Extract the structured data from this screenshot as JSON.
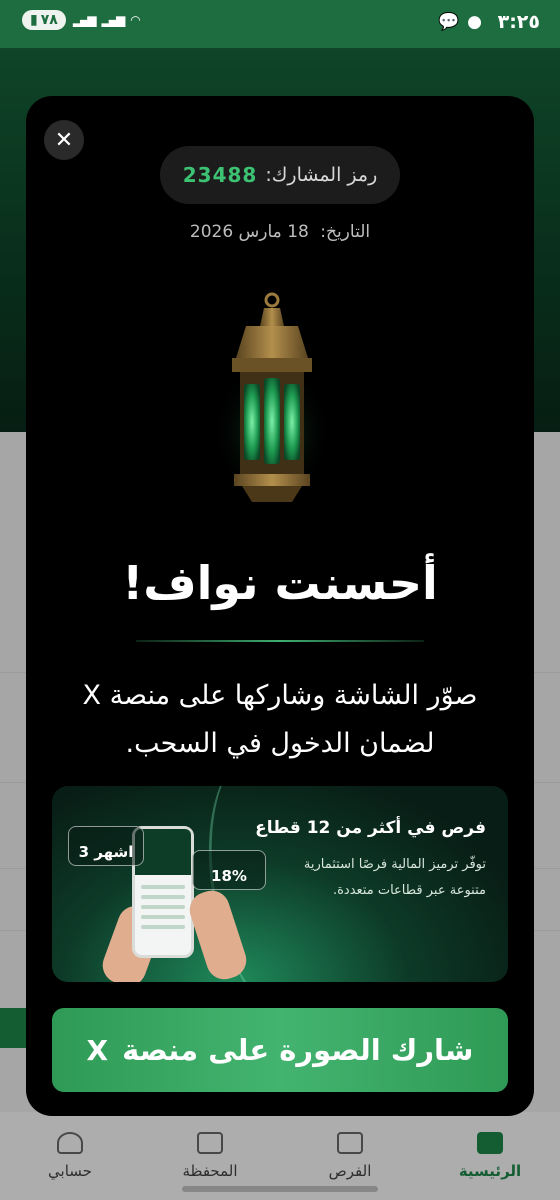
{
  "status_bar": {
    "time": "٣:٢٥",
    "battery": "٧٨"
  },
  "bottom_nav": {
    "items": [
      {
        "label": "الرئيسية",
        "icon": "home-icon",
        "active": true
      },
      {
        "label": "الفرص",
        "icon": "opportunities-icon",
        "active": false
      },
      {
        "label": "المحفظة",
        "icon": "wallet-icon",
        "active": false
      },
      {
        "label": "حسابي",
        "icon": "profile-icon",
        "active": false
      }
    ]
  },
  "modal": {
    "participant_code_label": "رمز المشارك:",
    "participant_code": "23488",
    "date_label": "التاريخ:",
    "date_value": "18 مارس 2026",
    "congrats": "أحسنت نواف!",
    "instruction": "صوّر الشاشة وشاركها على منصة X لضمان الدخول في السحب.",
    "promo": {
      "title": "فرص في أكثر من 12 قطاع",
      "text": "توفّر ترميز المالية فرصًا استثمارية متنوعة عبر قطاعات متعددة.",
      "stat_duration": "3 اشهر",
      "stat_return": "18%"
    },
    "share_button": "شارك الصورة على منصة",
    "share_x": "X"
  },
  "colors": {
    "accent_green": "#3dc273",
    "brand_green": "#1e6d40",
    "button_green": "#43b470"
  }
}
